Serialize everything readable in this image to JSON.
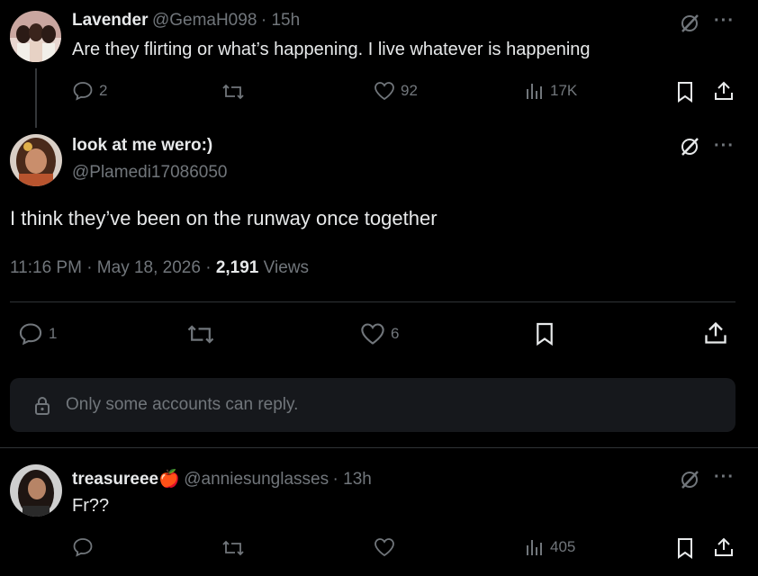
{
  "tweet1": {
    "display_name": "Lavender",
    "handle": "@GemaH098",
    "time": "· 15h",
    "text": "Are they flirting or what’s happening. I live whatever is happening",
    "replies": "2",
    "likes": "92",
    "views": "17K"
  },
  "tweet2": {
    "display_name": "look at me wero:)",
    "handle": "@Plamedi17086050",
    "text": "I think they’ve been on the runway once together",
    "timestamp": "11:16 PM · May 18, 2026 · ",
    "views_count": "2,191",
    "views_label": " Views",
    "replies": "1",
    "likes": "6"
  },
  "reply_restriction": {
    "text": "Only some accounts can reply."
  },
  "tweet3": {
    "display_name": "treasureee",
    "emoji": "🍎",
    "handle": "@anniesunglasses",
    "time": "· 13h",
    "text": "Fr??",
    "views": "405"
  },
  "colors": {
    "background": "#000000",
    "text": "#e7e9ea",
    "muted": "#71767b",
    "divider": "#2f3336",
    "panel": "#16181c"
  },
  "icons": [
    "reply-icon",
    "retweet-icon",
    "like-icon",
    "views-icon",
    "bookmark-icon",
    "share-icon",
    "grok-icon",
    "more-icon",
    "lock-icon"
  ]
}
